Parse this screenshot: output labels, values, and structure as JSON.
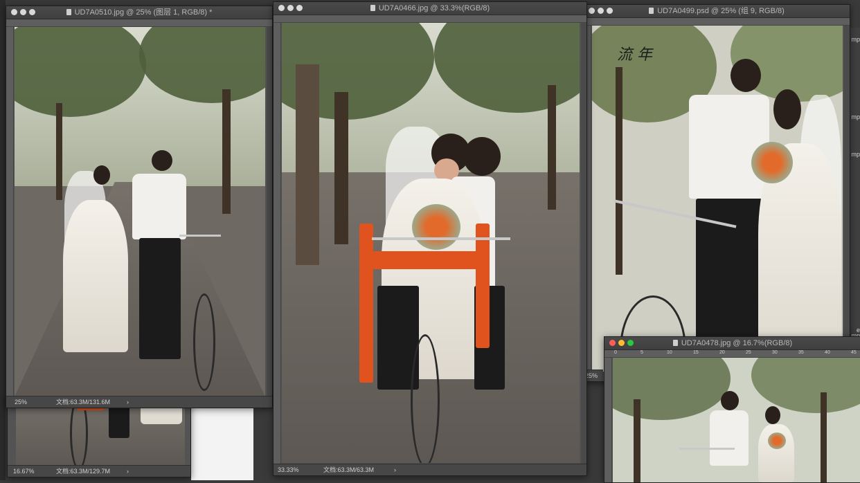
{
  "windows": [
    {
      "id": "w1",
      "title": "UD7A0510.jpg @ 25% (图层 1, RGB/8) *",
      "zoom": "25%",
      "doc_size": "文档:63.3M/131.6M",
      "status_arrow": "›"
    },
    {
      "id": "w2",
      "title": "UD7A0466.jpg @ 33.3%(RGB/8)",
      "zoom": "33.33%",
      "doc_size": "文档:63.3M/63.3M",
      "status_arrow": "›"
    },
    {
      "id": "w3",
      "title": "UD7A0499.psd @ 25% (组 9, RGB/8)",
      "zoom": "25%",
      "signature_text": "流 年"
    },
    {
      "id": "w4",
      "title": "UD7A0478.jpg @ 16.7%(RGB/8)",
      "ruler_ticks": [
        "0",
        "5",
        "10",
        "15",
        "20",
        "25",
        "30",
        "35",
        "40",
        "45"
      ]
    },
    {
      "id": "w5",
      "zoom": "16.67%",
      "doc_size": "文档:63.3M/129.7M",
      "status_arrow": "›"
    }
  ],
  "desktop": {
    "right_labels": [
      "mp",
      "mp",
      "mp",
      "e",
      "mp"
    ]
  },
  "colors": {
    "window_chrome": "#535353",
    "titlebar": "#3f3f3f",
    "sash": "#e0531e",
    "close_red": "#fe5f57",
    "minimize_yellow": "#febc2e",
    "zoom_green": "#28c840"
  }
}
